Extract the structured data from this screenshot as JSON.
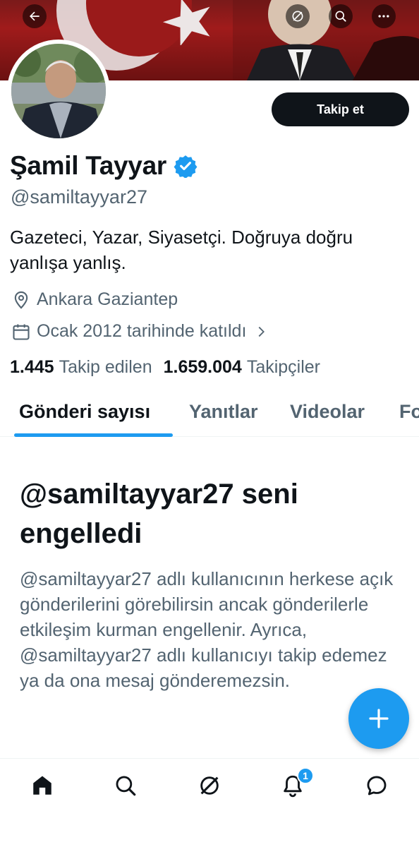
{
  "header": {
    "back_icon": "back-arrow-icon",
    "grok_icon": "grok-icon",
    "search_icon": "search-icon",
    "more_icon": "more-icon"
  },
  "profile": {
    "follow_label": "Takip et",
    "name": "Şamil Tayyar",
    "handle": "@samiltayyar27",
    "bio": "Gazeteci, Yazar, Siyasetçi. Doğruya doğru yanlışa yanlış.",
    "location": "Ankara Gaziantep",
    "joined": "Ocak 2012 tarihinde katıldı",
    "following_count": "1.445",
    "following_label": "Takip edilen",
    "followers_count": "1.659.004",
    "followers_label": "Takipçiler"
  },
  "tabs": [
    {
      "label": "Gönderi sayısı"
    },
    {
      "label": "Yanıtlar"
    },
    {
      "label": "Videolar"
    },
    {
      "label": "Fo"
    }
  ],
  "blocked": {
    "title": "@samiltayyar27 seni engelledi",
    "description": "@samiltayyar27 adlı kullanıcının herkese açık gönderilerini görebilirsin ancak gönderilerle etkileşim kurman engellenir. Ayrıca, @samiltayyar27 adlı kullanıcıyı takip edemez ya da ona mesaj gönderemezsin."
  },
  "notification_badge": "1",
  "colors": {
    "accent": "#1d9bf0",
    "text": "#0f1419",
    "secondary_text": "#536471"
  }
}
